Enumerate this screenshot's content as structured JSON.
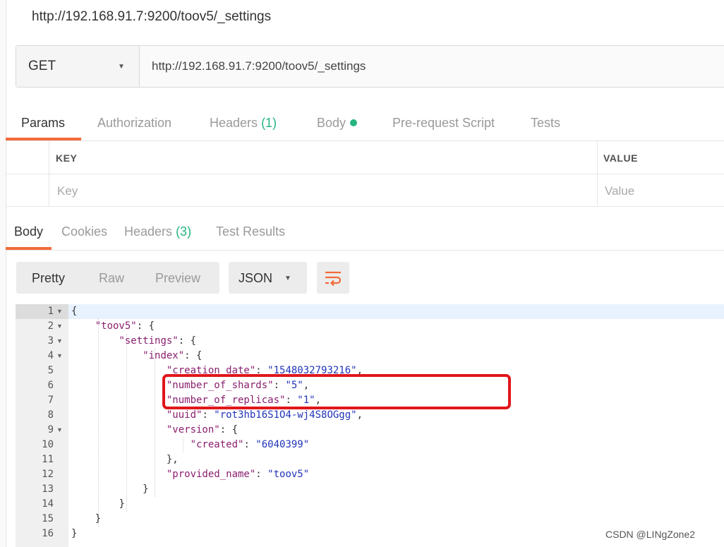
{
  "request": {
    "title": "http://192.168.91.7:9200/toov5/_settings",
    "method": "GET",
    "url": "http://192.168.91.7:9200/toov5/_settings"
  },
  "request_tabs": [
    {
      "label": "Params"
    },
    {
      "label": "Authorization"
    },
    {
      "label": "Headers",
      "count": "(1)"
    },
    {
      "label": "Body"
    },
    {
      "label": "Pre-request Script"
    },
    {
      "label": "Tests"
    }
  ],
  "params_table": {
    "headers": [
      "KEY",
      "VALUE"
    ],
    "placeholders": [
      "Key",
      "Value"
    ]
  },
  "response_tabs": [
    {
      "label": "Body"
    },
    {
      "label": "Cookies"
    },
    {
      "label": "Headers",
      "count": "(3)"
    },
    {
      "label": "Test Results"
    }
  ],
  "view_modes": [
    "Pretty",
    "Raw",
    "Preview"
  ],
  "format": "JSON",
  "line_numbers": [
    "1",
    "2",
    "3",
    "4",
    "5",
    "6",
    "7",
    "8",
    "9",
    "10",
    "11",
    "12",
    "13",
    "14",
    "15",
    "16"
  ],
  "code": {
    "brace_open": "{",
    "brace_close": "}",
    "colon": ": ",
    "comma": ",",
    "toov5_key": "\"toov5\"",
    "settings_key": "\"settings\"",
    "index_key": "\"index\"",
    "creation_date_key": "\"creation_date\"",
    "creation_date_val": "\"1548032793216\"",
    "shards_key": "\"number_of_shards\"",
    "shards_val": "\"5\"",
    "replicas_key": "\"number_of_replicas\"",
    "replicas_val": "\"1\"",
    "uuid_key": "\"uuid\"",
    "uuid_val": "\"rot3hb16S1O4-wj4S8OGgg\"",
    "version_key": "\"version\"",
    "created_key": "\"created\"",
    "created_val": "\"6040399\"",
    "close_with_comma": "},",
    "provided_name_key": "\"provided_name\"",
    "provided_name_val": "\"toov5\""
  },
  "watermark": "CSDN @LINgZone2",
  "colors": {
    "accent": "#f26b3a",
    "count": "#26b47f",
    "highlight_box": "#e0161a"
  }
}
